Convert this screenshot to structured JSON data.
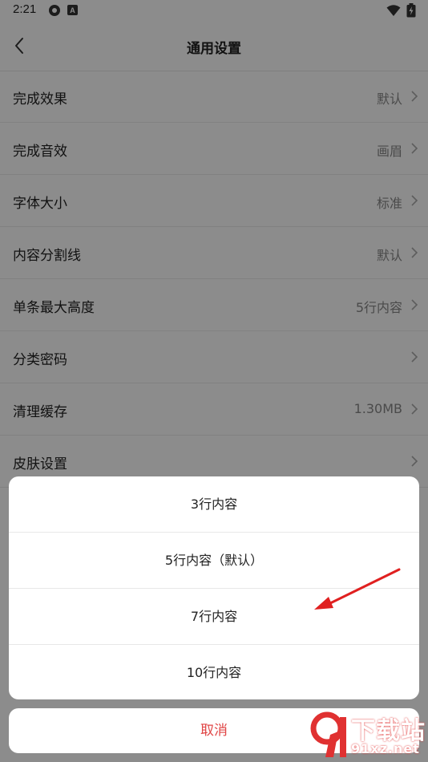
{
  "status_bar": {
    "time": "2:21"
  },
  "header": {
    "title": "通用设置",
    "back_icon": "chevron-left-icon"
  },
  "settings": {
    "items": [
      {
        "label": "完成效果",
        "value": "默认"
      },
      {
        "label": "完成音效",
        "value": "画眉"
      },
      {
        "label": "字体大小",
        "value": "标准"
      },
      {
        "label": "内容分割线",
        "value": "默认"
      },
      {
        "label": "单条最大高度",
        "value": "5行内容"
      },
      {
        "label": "分类密码",
        "value": ""
      },
      {
        "label": "清理缓存",
        "value": "1.30MB"
      },
      {
        "label": "皮肤设置",
        "value": ""
      }
    ]
  },
  "option_sheet": {
    "options": [
      {
        "label": "3行内容"
      },
      {
        "label": "5行内容（默认）"
      },
      {
        "label": "7行内容"
      },
      {
        "label": "10行内容"
      }
    ]
  },
  "cancel": {
    "label": "取消"
  },
  "watermark": {
    "big": "下载站",
    "small": "91xz.net"
  },
  "colors": {
    "cancel_text": "#e04545",
    "annotation_arrow": "#e02020",
    "watermark_red": "#e03131"
  }
}
